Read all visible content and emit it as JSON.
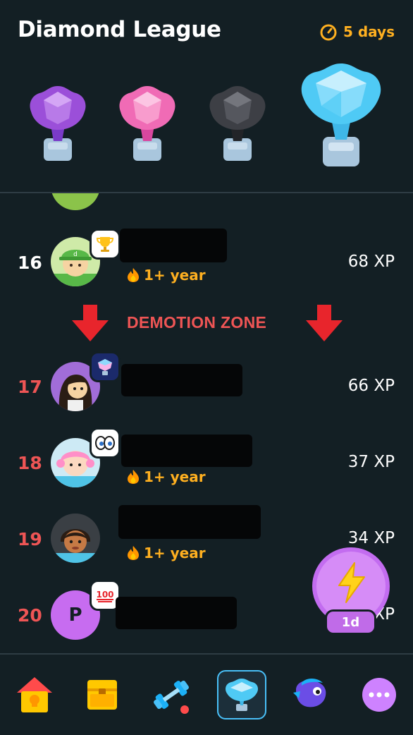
{
  "header": {
    "title": "Diamond League",
    "timer_text": "5 days",
    "trophies": [
      "amethyst-trophy",
      "pearl-trophy",
      "obsidian-trophy",
      "diamond-trophy"
    ]
  },
  "leaderboard": {
    "rows": [
      {
        "rank": "16",
        "xp": "68 XP",
        "streak": "1+ year",
        "badge": "trophy-icon",
        "zone": "safe"
      },
      {
        "rank": "17",
        "xp": "66 XP",
        "streak": "",
        "badge": "diamond-icon",
        "zone": "demotion"
      },
      {
        "rank": "18",
        "xp": "37 XP",
        "streak": "1+ year",
        "badge": "eyes-icon",
        "zone": "demotion"
      },
      {
        "rank": "19",
        "xp": "34 XP",
        "streak": "1+ year",
        "badge": "",
        "zone": "demotion"
      },
      {
        "rank": "20",
        "xp": "XP",
        "streak": "",
        "badge": "hundred-icon",
        "zone": "demotion",
        "avatar_letter": "P"
      }
    ],
    "demotion_label": "DEMOTION ZONE"
  },
  "fab": {
    "label": "1d",
    "icon": "lightning-icon"
  },
  "nav": {
    "items": [
      "home-icon",
      "chest-icon",
      "dumbbell-icon",
      "leagues-icon",
      "duo-icon",
      "more-icon"
    ],
    "active": "leagues-icon"
  },
  "colors": {
    "background": "#131f24",
    "accent_orange": "#ffb020",
    "demotion_red": "#ee5555",
    "active_blue": "#49c0f8",
    "fab_purple": "#c36cf0"
  }
}
